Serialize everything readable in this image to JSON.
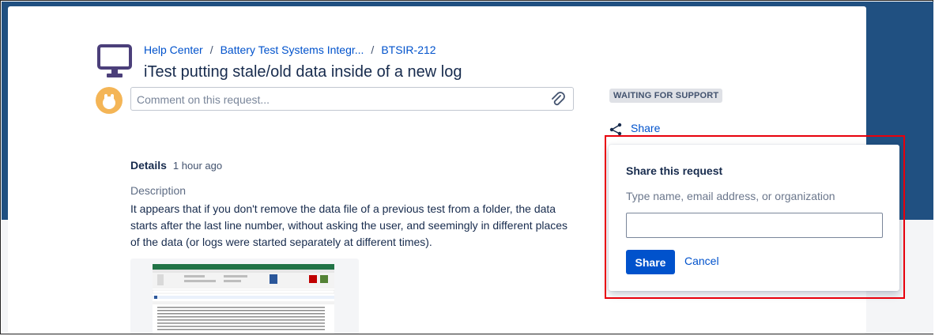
{
  "breadcrumb": {
    "items": [
      "Help Center",
      "Battery Test Systems Integr...",
      "BTSIR-212"
    ],
    "separator": "/"
  },
  "request": {
    "title": "iTest putting stale/old data inside of a new log",
    "status": "WAITING FOR SUPPORT"
  },
  "comment": {
    "placeholder": "Comment on this request..."
  },
  "share": {
    "label": "Share"
  },
  "details": {
    "heading": "Details",
    "time": "1 hour ago",
    "description_label": "Description",
    "description": "It appears that if you don't remove the data file of a previous test from a folder, the data starts after the last line number, without asking the user, and seemingly in different places of the data (or logs were started separately at different times)."
  },
  "share_popup": {
    "heading": "Share this request",
    "hint": "Type name, email address, or organization",
    "input_value": "",
    "share_button": "Share",
    "cancel_button": "Cancel"
  },
  "icons": {
    "monitor": "monitor-icon",
    "avatar": "user-avatar",
    "attachment": "paperclip-icon",
    "share": "share-icon"
  },
  "colors": {
    "brand_header": "#205081",
    "link": "#0052cc",
    "primary_button": "#0052cc",
    "status_badge_bg": "#dfe1e6",
    "annotation_outline": "#e8000b",
    "monitor_icon": "#4b3f7a",
    "avatar_bg": "#f4b556"
  }
}
